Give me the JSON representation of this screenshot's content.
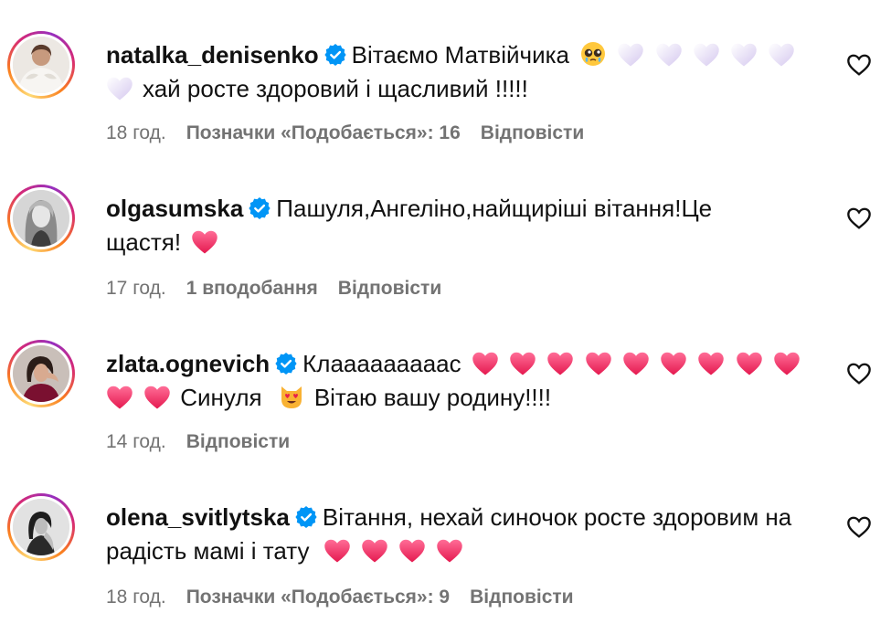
{
  "comments": [
    {
      "username": "natalka_denisenko",
      "text_before": "Вітаємо Матвійчика",
      "text_after": "хай росте здоровий і щасливий !!!!!",
      "time": "18 год.",
      "likes": "Позначки «Подобається»: 16",
      "reply": "Відповісти",
      "emojis_line": [
        "pleading-face",
        "white-heart",
        "white-heart",
        "white-heart",
        "white-heart",
        "white-heart",
        "white-heart"
      ]
    },
    {
      "username": "olgasumska",
      "text_before": "Пашуля,Ангеліно,найщиріші вітання!Це щастя!",
      "time": "17 год.",
      "likes": "1 вподобання",
      "reply": "Відповісти",
      "emojis_line": [
        "pink-heart"
      ]
    },
    {
      "username": "zlata.ognevich",
      "text_before": "Клааааааааас",
      "text_mid": "Синуля",
      "text_after": "Вітаю вашу родину!!!!",
      "time": "14 год.",
      "reply": "Відповісти",
      "emojis_line": [
        "pink-heart",
        "pink-heart",
        "pink-heart",
        "pink-heart",
        "pink-heart",
        "pink-heart",
        "pink-heart",
        "pink-heart",
        "pink-heart",
        "pink-heart",
        "pink-heart",
        "heart-eyes-cat"
      ]
    },
    {
      "username": "olena_svitlytska",
      "text_before": "Вітання, нехай синочок росте здоровим на радість мамі і тату",
      "time": "18 год.",
      "likes": "Позначки «Подобається»: 9",
      "reply": "Відповісти",
      "emojis_line": [
        "pink-heart",
        "pink-heart",
        "pink-heart",
        "pink-heart"
      ]
    }
  ],
  "colors": {
    "text": "#111111",
    "meta": "#737373",
    "verified": "#0095f6",
    "pink_heart": "#f0306a",
    "white_heart": "#e3dbf5"
  }
}
